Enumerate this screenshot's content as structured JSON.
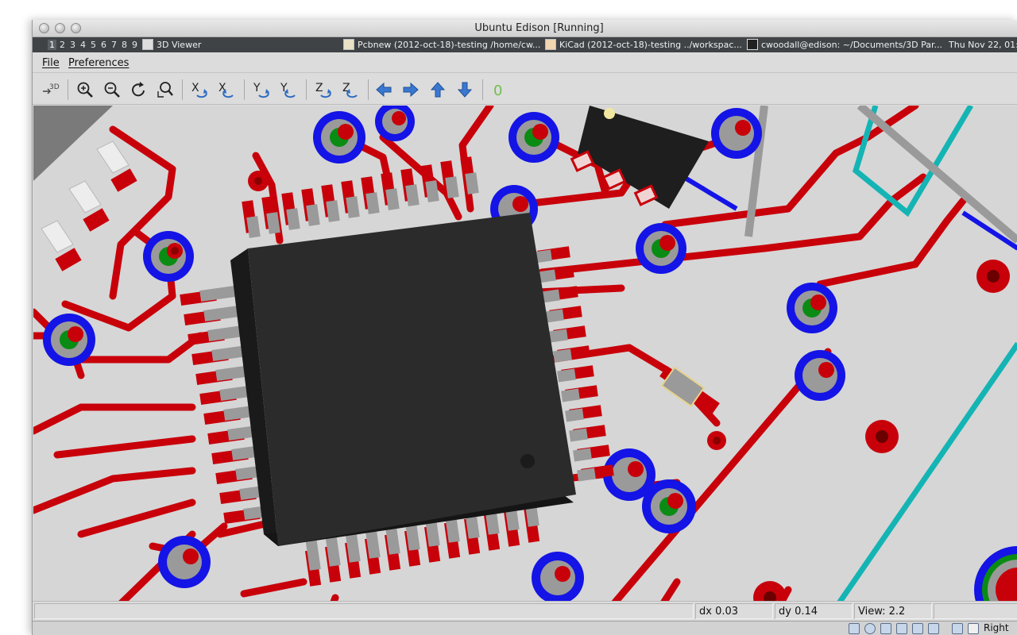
{
  "window": {
    "title": "Ubuntu Edison [Running]"
  },
  "panel": {
    "workspaces": [
      "1",
      "2",
      "3",
      "4",
      "5",
      "6",
      "7",
      "8",
      "9"
    ],
    "tasks": [
      {
        "icon": "3d-viewer-icon",
        "label": "3D Viewer"
      },
      {
        "icon": "pcbnew-icon",
        "label": "Pcbnew (2012-oct-18)-testing /home/cw..."
      },
      {
        "icon": "kicad-icon",
        "label": "KiCad (2012-oct-18)-testing ../workspac..."
      },
      {
        "icon": "terminal-icon",
        "label": "cwoodall@edison: ~/Documents/3D Par..."
      }
    ],
    "clock": "Thu Nov 22, 01:"
  },
  "menu": {
    "file": "File",
    "preferences": "Preferences"
  },
  "toolbar": {
    "buttons": [
      {
        "name": "3d-options-button",
        "icon": "3d-options-icon",
        "label": "3D"
      },
      {
        "name": "zoom-in-button",
        "icon": "zoom-in-icon",
        "label": ""
      },
      {
        "name": "zoom-out-button",
        "icon": "zoom-out-icon",
        "label": ""
      },
      {
        "name": "redraw-button",
        "icon": "redraw-icon",
        "label": ""
      },
      {
        "name": "zoom-fit-button",
        "icon": "zoom-fit-icon",
        "label": ""
      },
      {
        "name": "rotate-x-neg-button",
        "icon": "rotate-x-icon",
        "label": "X"
      },
      {
        "name": "rotate-x-pos-button",
        "icon": "rotate-x-icon",
        "label": "X"
      },
      {
        "name": "rotate-y-neg-button",
        "icon": "rotate-y-icon",
        "label": "Y"
      },
      {
        "name": "rotate-y-pos-button",
        "icon": "rotate-y-icon",
        "label": "Y"
      },
      {
        "name": "rotate-z-neg-button",
        "icon": "rotate-z-icon",
        "label": "Z"
      },
      {
        "name": "rotate-z-pos-button",
        "icon": "rotate-z-icon",
        "label": "Z"
      },
      {
        "name": "move-left-button",
        "icon": "arrow-left-icon",
        "label": ""
      },
      {
        "name": "move-right-button",
        "icon": "arrow-right-icon",
        "label": ""
      },
      {
        "name": "move-up-button",
        "icon": "arrow-up-icon",
        "label": ""
      },
      {
        "name": "move-down-button",
        "icon": "arrow-down-icon",
        "label": ""
      },
      {
        "name": "ortho-button",
        "icon": "ortho-icon",
        "label": "0"
      }
    ]
  },
  "status": {
    "dx": "dx 0.03",
    "dy": "dy 0.14",
    "view": "View: 2.2"
  },
  "host": {
    "right_ctrl": "Right"
  },
  "colors": {
    "board": "#d6d6d6",
    "trace": "#c8000a",
    "via_blue": "#1414e6",
    "via_green": "#0a8c14",
    "silk": "#14b4b4",
    "chip": "#2a2a2a",
    "pad": "#9a9a9a"
  }
}
